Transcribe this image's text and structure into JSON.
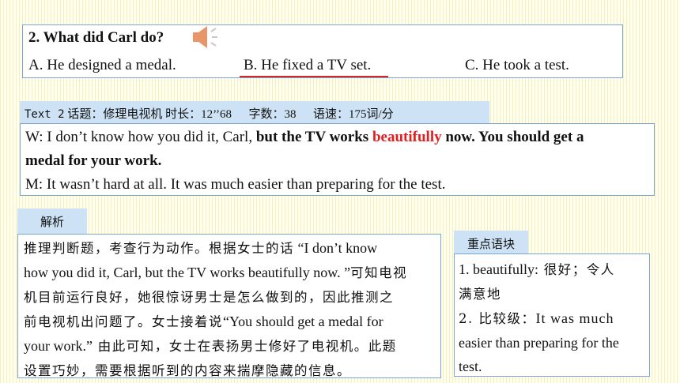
{
  "question": {
    "title": "2. What did Carl do?",
    "option_a": "A. He designed a medal.",
    "option_b": "B. He fixed a TV set.",
    "option_c": "C. He took a test.",
    "underline_color": "#d62828",
    "speaker_icon": "speaker-icon"
  },
  "transcript": {
    "header_text": "Text 2",
    "header_topic": "话题：修理电视机",
    "header_duration": "时长：12’’68",
    "header_words": "字数：38",
    "header_speed": "语速：175词/分",
    "w_part1": "W: I don’t know how you did it, Carl, ",
    "w_part2": "but the TV works ",
    "w_highlight": "beautifully",
    "w_part3": " now. You should get a",
    "w_part4": "medal for your work.",
    "m_line": "M: It wasn’t hard at all. It was much easier than preparing for the test."
  },
  "analysis": {
    "tab_label": "解析",
    "l1_cn": "推理判断题，考查行为动作。根据女士的话",
    "l1_en": " “I don’t know",
    "l2_en": "how you did it, Carl, but the TV works beautifully now. ”",
    "l2_cn": "可知电视",
    "l3_cn": "机目前运行良好，她很惊讶男士是怎么做到的，因此推测之",
    "l4_cn": "前电视机出问题了。女士接着说",
    "l4_en": "“You should get a medal for",
    "l5_en": "your work.”",
    "l5_cn": " 由此可知，女士在表扬男士修好了电视机。此题",
    "l6_cn": "设置巧妙，需要根据听到的内容来揣摩隐藏的信息。"
  },
  "phrases": {
    "tab_label": "重点语块",
    "p1_en": "1. beautifully:",
    "p1_cn": " 很好；令人",
    "p2_cn": "满意地",
    "p3_prefix": "2. 比较级：",
    "p3_en": "It was much",
    "p4_en": "easier than preparing for the",
    "p5_en": "test."
  }
}
